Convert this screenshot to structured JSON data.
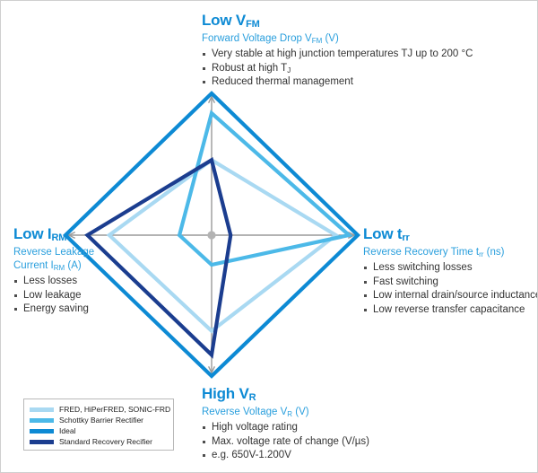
{
  "sections": {
    "vfm": {
      "heading": "Low V",
      "heading_sub": "FM",
      "subtitle": "Forward Voltage Drop V",
      "subtitle_sub": "FM",
      "subtitle_tail": " (V)",
      "bullets": [
        "Very stable at high junction temperatures TJ up to 200 °C",
        "Robust at high T",
        "Reduced thermal management"
      ],
      "bullet2_sub": "J"
    },
    "trr": {
      "heading": "Low t",
      "heading_sub": "rr",
      "subtitle": "Reverse Recovery Time t",
      "subtitle_sub": "rr",
      "subtitle_tail": " (ns)",
      "bullets": [
        "Less switching losses",
        "Fast switching",
        "Low internal drain/source inductance",
        "Low reverse transfer capacitance"
      ]
    },
    "vr": {
      "heading": "High V",
      "heading_sub": "R",
      "subtitle": "Reverse Voltage V",
      "subtitle_sub": "R",
      "subtitle_tail": " (V)",
      "bullets": [
        "High voltage rating",
        "Max. voltage rate of change (V/µs)",
        "e.g. 650V-1.200V"
      ]
    },
    "irm": {
      "heading": "Low I",
      "heading_sub": "RM",
      "subtitle": "Reverse Leakage",
      "subtitle_line2": "Current I",
      "subtitle_sub": "RM",
      "subtitle_tail": " (A)",
      "bullets": [
        "Less losses",
        "Low leakage",
        "Energy saving"
      ]
    }
  },
  "legend": {
    "items": [
      {
        "label": "FRED, HiPerFRED, SONIC-FRD",
        "color": "#a9d9f2"
      },
      {
        "label": "Schottky Barrier Rectifier",
        "color": "#4cb9e8"
      },
      {
        "label": "Ideal",
        "color": "#0d8ad4"
      },
      {
        "label": "Standard Recovery Recifier",
        "color": "#1b3d8f"
      }
    ]
  },
  "chart_data": {
    "type": "radar",
    "title": "",
    "axes": [
      {
        "key": "vfm",
        "label": "Low V_FM",
        "angle_deg": 90
      },
      {
        "key": "trr",
        "label": "Low t_rr",
        "angle_deg": 0
      },
      {
        "key": "vr",
        "label": "High V_R",
        "angle_deg": 270
      },
      {
        "key": "irm",
        "label": "Low I_RM",
        "angle_deg": 180
      }
    ],
    "categories": [
      "Low V_FM",
      "Low t_rr",
      "High V_R",
      "Low I_RM"
    ],
    "scale_max": 100,
    "grid": "cross-axes-with-arrows",
    "legend_position": "bottom-left",
    "series": [
      {
        "name": "FRED, HiPerFRED, SONIC-FRD",
        "color": "#a9d9f2",
        "values": {
          "vfm": 53,
          "trr": 85,
          "vr": 68,
          "irm": 70
        }
      },
      {
        "name": "Schottky Barrier Rectifier",
        "color": "#4cb9e8",
        "values": {
          "vfm": 86,
          "trr": 94,
          "vr": 21,
          "irm": 22
        }
      },
      {
        "name": "Ideal",
        "color": "#0d8ad4",
        "values": {
          "vfm": 100,
          "trr": 100,
          "vr": 100,
          "irm": 100
        }
      },
      {
        "name": "Standard Recovery Recifier",
        "color": "#1b3d8f",
        "values": {
          "vfm": 53,
          "trr": 13,
          "vr": 85,
          "irm": 85
        }
      }
    ]
  },
  "geometry": {
    "center_x": 235,
    "center_y": 261,
    "axis_up_tip_y": 103,
    "axis_down_tip_y": 418,
    "axis_left_tip_x": 72,
    "axis_right_tip_x": 398
  }
}
